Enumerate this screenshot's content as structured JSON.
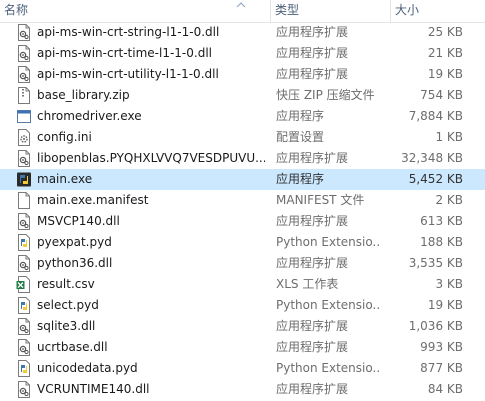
{
  "columns": {
    "name": "名称",
    "type": "类型",
    "size": "大小"
  },
  "files": [
    {
      "name": "api-ms-win-crt-string-l1-1-0.dll",
      "type": "应用程序扩展",
      "size": "25 KB",
      "icon": "dll-icon"
    },
    {
      "name": "api-ms-win-crt-time-l1-1-0.dll",
      "type": "应用程序扩展",
      "size": "21 KB",
      "icon": "dll-icon"
    },
    {
      "name": "api-ms-win-crt-utility-l1-1-0.dll",
      "type": "应用程序扩展",
      "size": "19 KB",
      "icon": "dll-icon"
    },
    {
      "name": "base_library.zip",
      "type": "快压 ZIP 压缩文件",
      "size": "754 KB",
      "icon": "zip-icon"
    },
    {
      "name": "chromedriver.exe",
      "type": "应用程序",
      "size": "7,884 KB",
      "icon": "exe-icon"
    },
    {
      "name": "config.ini",
      "type": "配置设置",
      "size": "1 KB",
      "icon": "ini-icon"
    },
    {
      "name": "libopenblas.PYQHXLVVQ7VESDPUVU...",
      "type": "应用程序扩展",
      "size": "32,348 KB",
      "icon": "dll-icon"
    },
    {
      "name": "main.exe",
      "type": "应用程序",
      "size": "5,452 KB",
      "icon": "python-exe-icon",
      "selected": true
    },
    {
      "name": "main.exe.manifest",
      "type": "MANIFEST 文件",
      "size": "2 KB",
      "icon": "file-icon"
    },
    {
      "name": "MSVCP140.dll",
      "type": "应用程序扩展",
      "size": "613 KB",
      "icon": "dll-icon"
    },
    {
      "name": "pyexpat.pyd",
      "type": "Python Extensio...",
      "size": "188 KB",
      "icon": "python-file-icon"
    },
    {
      "name": "python36.dll",
      "type": "应用程序扩展",
      "size": "3,535 KB",
      "icon": "dll-icon"
    },
    {
      "name": "result.csv",
      "type": "XLS 工作表",
      "size": "3 KB",
      "icon": "csv-icon"
    },
    {
      "name": "select.pyd",
      "type": "Python Extensio...",
      "size": "19 KB",
      "icon": "python-file-icon"
    },
    {
      "name": "sqlite3.dll",
      "type": "应用程序扩展",
      "size": "1,036 KB",
      "icon": "dll-icon"
    },
    {
      "name": "ucrtbase.dll",
      "type": "应用程序扩展",
      "size": "993 KB",
      "icon": "dll-icon"
    },
    {
      "name": "unicodedata.pyd",
      "type": "Python Extensio...",
      "size": "877 KB",
      "icon": "python-file-icon"
    },
    {
      "name": "VCRUNTIME140.dll",
      "type": "应用程序扩展",
      "size": "84 KB",
      "icon": "dll-icon"
    }
  ]
}
